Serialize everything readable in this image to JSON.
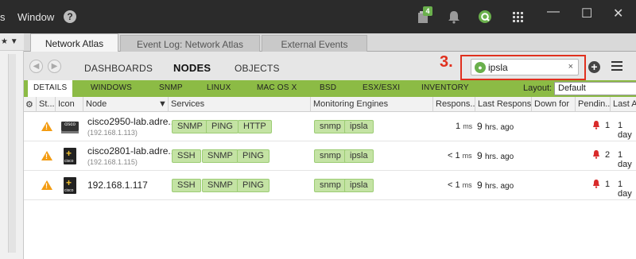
{
  "titlebar": {
    "menu_1": "s",
    "menu_2": "Window",
    "help_glyph": "?",
    "notification_count": "4",
    "icons": [
      "clipboard-icon",
      "bell-icon",
      "app-logo-icon",
      "grid-menu-icon"
    ]
  },
  "leftpane": {
    "header": "★ ▼"
  },
  "tabs": [
    {
      "label": "Network Atlas",
      "active": true
    },
    {
      "label": "Event Log: Network Atlas",
      "active": false
    },
    {
      "label": "External Events",
      "active": false
    }
  ],
  "nav": {
    "links": [
      "DASHBOARDS",
      "NODES",
      "OBJECTS"
    ],
    "active": "NODES",
    "annotation": "3.",
    "search": {
      "value": "ipsla",
      "icon": "app-logo-icon",
      "clear": "×"
    }
  },
  "filters": {
    "tabs": [
      "DETAILS",
      "WINDOWS",
      "SNMP",
      "LINUX",
      "MAC OS X",
      "BSD",
      "ESX/ESXI",
      "INVENTORY"
    ],
    "active": "DETAILS",
    "layout_label": "Layout:",
    "layout_value": "Default"
  },
  "grid": {
    "columns": [
      "St...",
      "Icon",
      "Node",
      "Services",
      "Monitoring Engines",
      "Respons...",
      "Last Response",
      "Down for",
      "Pendin...",
      "Last A"
    ],
    "rows": [
      {
        "status": "warning",
        "icon": "cisco-switch",
        "node_name": "cisco2950-lab.adre...",
        "node_ip": "(192.168.1.113)",
        "services": [
          "SNMP",
          "PING",
          "HTTP"
        ],
        "engines": [
          "snmp",
          "ipsla"
        ],
        "response_value": "1",
        "response_unit": "ms",
        "last_response_value": "9",
        "last_response_unit": "hrs. ago",
        "pending": "1",
        "last_a": "1 day"
      },
      {
        "status": "warning",
        "icon": "cisco-router",
        "node_name": "cisco2801-lab.adre...",
        "node_ip": "(192.168.1.115)",
        "services": [
          "SSH",
          "SNMP",
          "PING"
        ],
        "engines": [
          "snmp",
          "ipsla"
        ],
        "response_value": "< 1",
        "response_unit": "ms",
        "last_response_value": "9",
        "last_response_unit": "hrs. ago",
        "pending": "2",
        "last_a": "1 day"
      },
      {
        "status": "warning",
        "icon": "cisco-router",
        "node_name": "192.168.1.117",
        "node_ip": "",
        "services": [
          "SSH",
          "SNMP",
          "PING"
        ],
        "engines": [
          "snmp",
          "ipsla"
        ],
        "response_value": "< 1",
        "response_unit": "ms",
        "last_response_value": "9",
        "last_response_unit": "hrs. ago",
        "pending": "1",
        "last_a": "1 day"
      }
    ]
  },
  "colors": {
    "titlebar": "#2b2b2b",
    "filter_bar": "#8cbb45",
    "pill": "#c4e3a4",
    "annotation": "#e0301e",
    "warning": "#f39c12",
    "bell": "#d92b2b"
  }
}
